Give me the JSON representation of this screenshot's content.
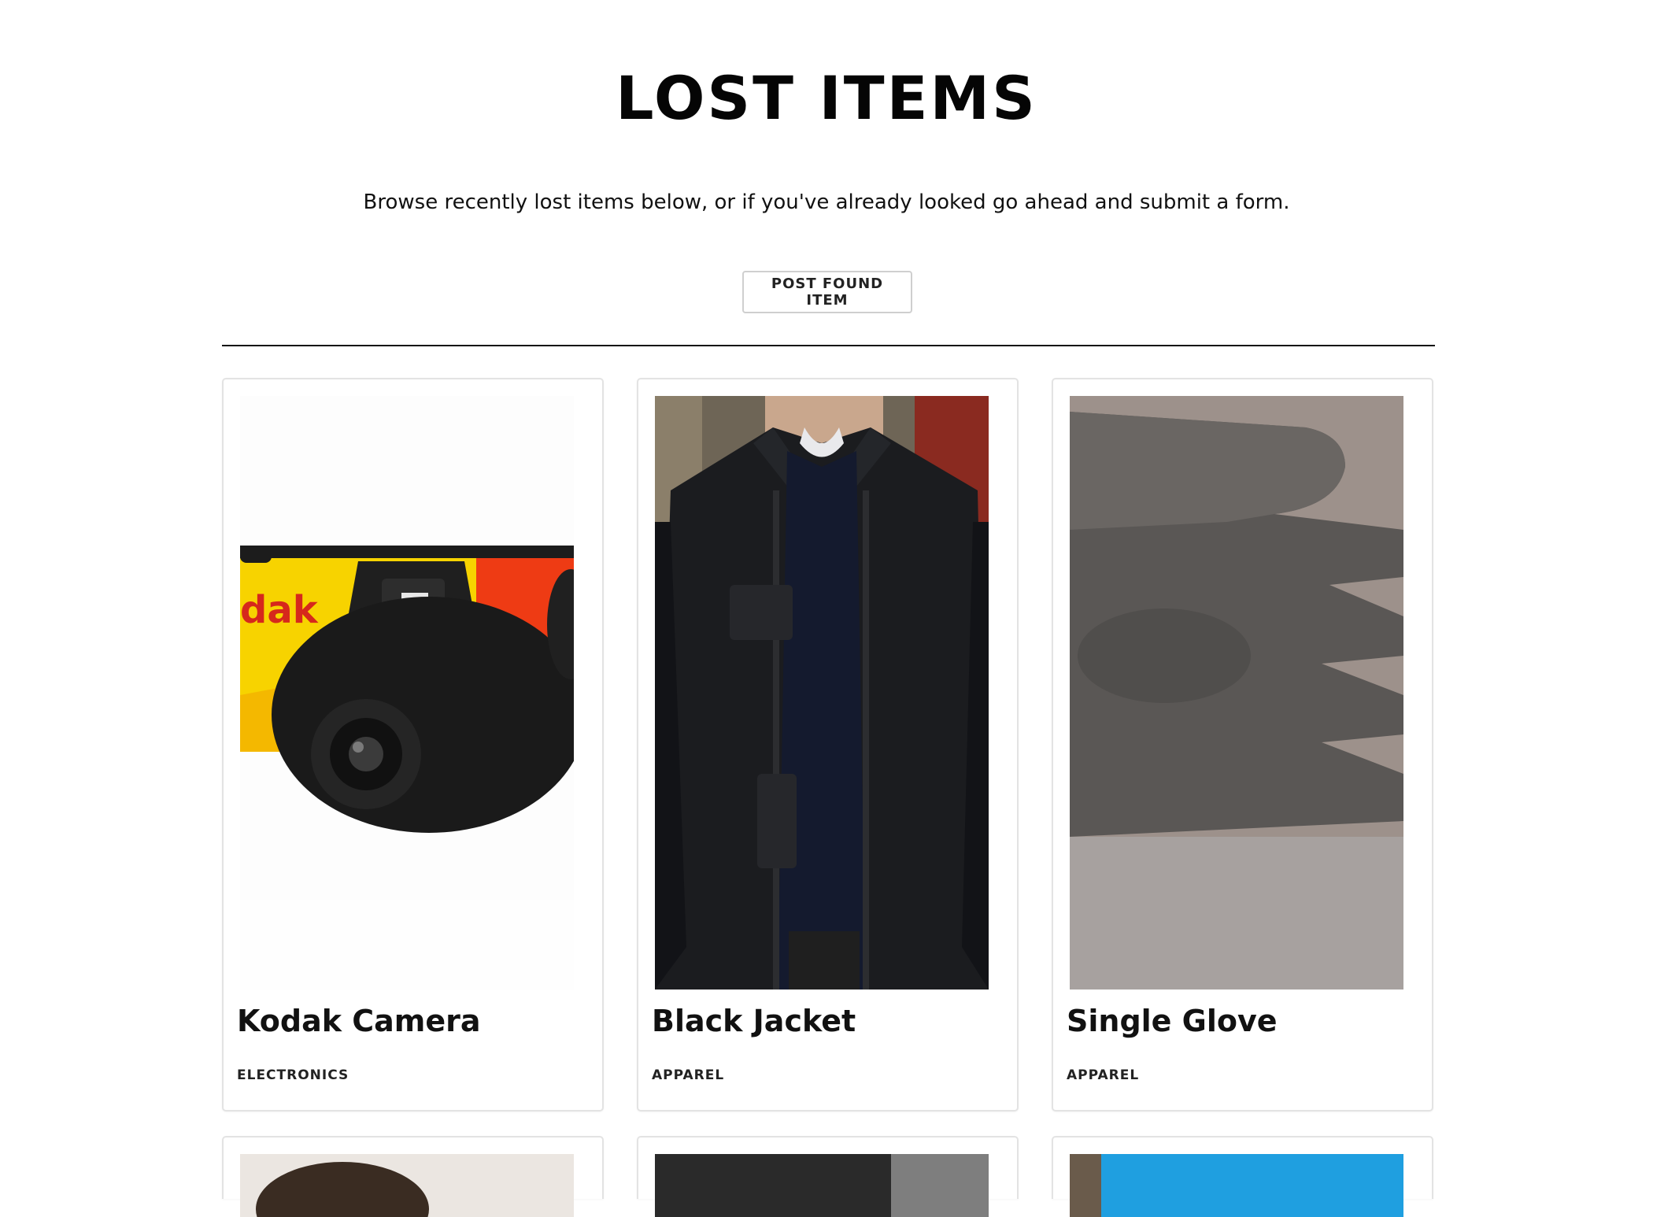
{
  "header": {
    "title": "LOST ITEMS",
    "subtitle": "Browse recently lost items below, or if you've already looked go ahead and submit a form.",
    "post_button_label": "POST FOUND ITEM"
  },
  "items": [
    {
      "name": "Kodak Camera",
      "category": "ELECTRONICS",
      "image": "kodak-camera-photo"
    },
    {
      "name": "Black Jacket",
      "category": "APPAREL",
      "image": "black-jacket-photo"
    },
    {
      "name": "Single Glove",
      "category": "APPAREL",
      "image": "single-glove-photo"
    }
  ],
  "partial_items": [
    {
      "image": "person-photo"
    },
    {
      "image": "dark-photo"
    },
    {
      "image": "blue-photo"
    }
  ],
  "camera_brand_text": "dak"
}
